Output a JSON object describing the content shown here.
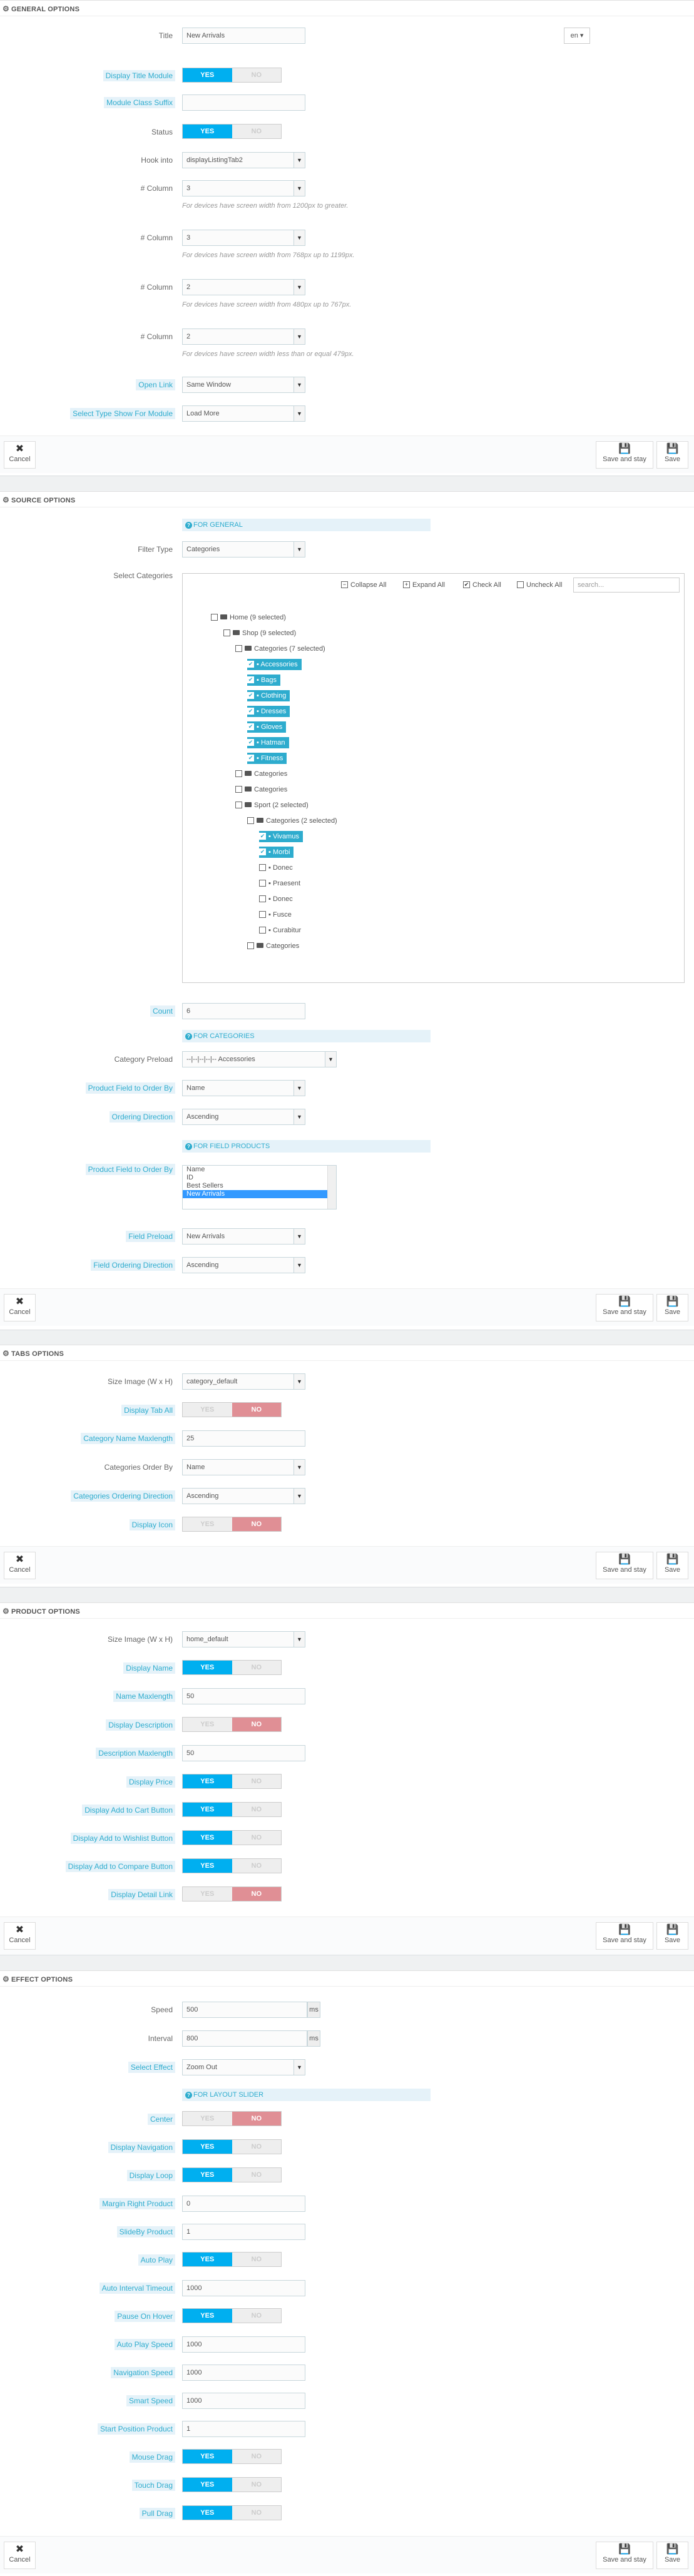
{
  "general": {
    "header": "GENERAL OPTIONS",
    "title_label": "Title",
    "title_value": "New Arrivals",
    "lang": "en",
    "display_title_label": "Display Title Module",
    "suffix_label": "Module Class Suffix",
    "suffix_value": "",
    "status_label": "Status",
    "hook_label": "Hook into",
    "hook_value": "displayListingTab2",
    "col_label": "# Column",
    "col1_value": "3",
    "col1_hint": "For devices have screen width from 1200px to greater.",
    "col2_value": "3",
    "col2_hint": "For devices have screen width from 768px up to 1199px.",
    "col3_value": "2",
    "col3_hint": "For devices have screen width from 480px up to 767px.",
    "col4_value": "2",
    "col4_hint": "For devices have screen width less than or equal 479px.",
    "openlink_label": "Open Link",
    "openlink_value": "Same Window",
    "showtype_label": "Select Type Show For Module",
    "showtype_value": "Load More"
  },
  "buttons": {
    "yes": "YES",
    "no": "NO",
    "cancel": "Cancel",
    "save_stay": "Save and stay",
    "save": "Save"
  },
  "source": {
    "header": "SOURCE OPTIONS",
    "for_general": "FOR GENERAL",
    "filter_label": "Filter Type",
    "filter_value": "Categories",
    "select_cat_label": "Select Categories",
    "collapse": "Collapse All",
    "expand": "Expand All",
    "check": "Check All",
    "uncheck": "Uncheck All",
    "search": "search...",
    "tree": {
      "home": "Home (9 selected)",
      "shop": "Shop (9 selected)",
      "categories7": "Categories (7 selected)",
      "accessories": "Accessories",
      "bags": "Bags",
      "clothing": "Clothing",
      "dresses": "Dresses",
      "gloves": "Gloves",
      "hatman": "Hatman",
      "fitness": "Fitness",
      "categories_a": "Categories",
      "categories_b": "Categories",
      "sport": "Sport (2 selected)",
      "categories2": "Categories (2 selected)",
      "vivamus": "Vivamus",
      "morbi": "Morbi",
      "donec1": "Donec",
      "praesent": "Praesent",
      "donec2": "Donec",
      "fusce": "Fusce",
      "curabitur": "Curabitur",
      "categories_c": "Categories"
    },
    "count_label": "Count",
    "count_value": "6",
    "for_categories": "FOR CATEGORIES",
    "preload_label": "Category Preload",
    "preload_value": "--|--|--|--|-- Accessories",
    "order_field_label": "Product Field to Order By",
    "order_field_value": "Name",
    "order_dir_label": "Ordering Direction",
    "order_dir_value": "Ascending",
    "for_field": "FOR FIELD PRODUCTS",
    "field_order_label": "Product Field to Order By",
    "field_options": [
      "Name",
      "ID",
      "Best Sellers",
      "New Arrivals"
    ],
    "field_preload_label": "Field Preload",
    "field_preload_value": "New Arrivals",
    "field_dir_label": "Field Ordering Direction",
    "field_dir_value": "Ascending"
  },
  "tabs": {
    "header": "TABS OPTIONS",
    "size_label": "Size Image (W x H)",
    "size_value": "category_default",
    "tab_all_label": "Display Tab All",
    "maxlen_label": "Category Name Maxlength",
    "maxlen_value": "25",
    "cat_order_label": "Categories Order By",
    "cat_order_value": "Name",
    "cat_dir_label": "Categories Ordering Direction",
    "cat_dir_value": "Ascending",
    "icon_label": "Display Icon"
  },
  "product": {
    "header": "PRODUCT OPTIONS",
    "size_label": "Size Image (W x H)",
    "size_value": "home_default",
    "name_label": "Display Name",
    "name_max_label": "Name Maxlength",
    "name_max_value": "50",
    "desc_label": "Display Description",
    "desc_max_label": "Description Maxlength",
    "desc_max_value": "50",
    "price_label": "Display Price",
    "cart_label": "Display Add to Cart Button",
    "wish_label": "Display Add to Wishlist Button",
    "compare_label": "Display Add to Compare Button",
    "detail_label": "Display Detail Link"
  },
  "effect": {
    "header": "EFFECT OPTIONS",
    "speed_label": "Speed",
    "speed_value": "500",
    "interval_label": "Interval",
    "interval_value": "800",
    "ms": "ms",
    "effect_label": "Select Effect",
    "effect_value": "Zoom Out",
    "for_slider": "FOR LAYOUT SLIDER",
    "center_label": "Center",
    "nav_label": "Display Navigation",
    "loop_label": "Display Loop",
    "margin_label": "Margin Right Product",
    "margin_value": "0",
    "slideby_label": "SlideBy Product",
    "slideby_value": "1",
    "autoplay_label": "Auto Play",
    "auto_int_label": "Auto Interval Timeout",
    "auto_int_value": "1000",
    "pause_label": "Pause On Hover",
    "autoplay_speed_label": "Auto Play Speed",
    "autoplay_speed_value": "1000",
    "nav_speed_label": "Navigation Speed",
    "nav_speed_value": "1000",
    "smart_label": "Smart Speed",
    "smart_value": "1000",
    "start_label": "Start Position Product",
    "start_value": "1",
    "mouse_label": "Mouse Drag",
    "touch_label": "Touch Drag",
    "pull_label": "Pull Drag"
  }
}
